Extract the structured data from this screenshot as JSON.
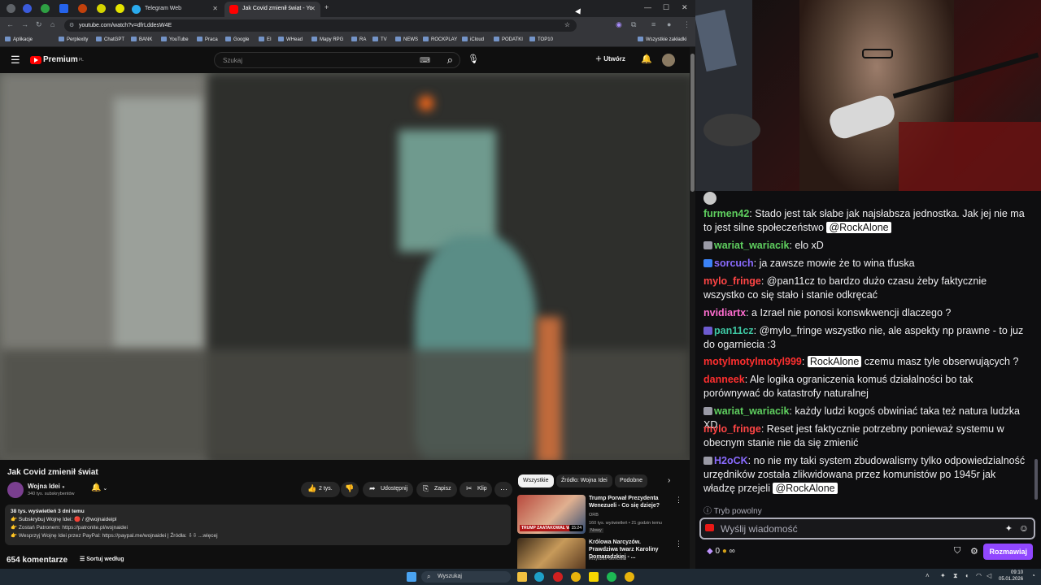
{
  "browser": {
    "tabs": [
      {
        "label": "Telegram Web"
      },
      {
        "label": "Jak Covid zmienił świat - Yo"
      }
    ],
    "url": "youtube.com/watch?v=dfrLddesW4E",
    "bookmarks": [
      "Aplikacje",
      "Perplexity",
      "ChatGPT",
      "BANK",
      "YouTube",
      "Praca",
      "Google",
      "EI",
      "WHead",
      "Mapy RPG",
      "RA",
      "TV",
      "NEWS",
      "ROCKPLAY",
      "iCloud",
      "PODATKI",
      "TOP10"
    ],
    "bookmarks_all": "Wszystkie zakładki"
  },
  "youtube": {
    "logo": "Premium",
    "logo_sup": "PL",
    "search_placeholder": "Szukaj",
    "create_label": "Utwórz",
    "video_title": "Jak Covid zmienił świat",
    "channel_name": "Wojna Idei",
    "subscribers": "340 tys. subskrybentów",
    "likes": "2 tys.",
    "share": "Udostępnij",
    "save": "Zapisz",
    "clip": "Klip",
    "desc_stats": "38 tys. wyświetleń  3 dni temu",
    "desc_lines": [
      "👉 Subskrybuj Wojnę Idei: 🔴 / @wojnaideipl",
      "👉 Zostań Patronem: https://patronite.pl/wojnaidei",
      "👉 Wesprzyj Wojnę Idei przez PayPal: https://paypal.me/wojnaidei  |  Źródła: ⇩⇩ ...więcej"
    ],
    "comments_count": "654 komentarze",
    "sort_label": "Sortuj według",
    "chips": [
      "Wszystkie",
      "Źródło: Wojna Idei",
      "Podobne"
    ],
    "related": [
      {
        "title": "Trump Porwał Prezydenta Wenezueli - Co się dzieje?",
        "channel": "ORB",
        "meta": "160 tys. wyświetleń • 21 godzin temu",
        "badge": "Nowy",
        "duration": "15:24",
        "thumb_caption": "TRUMP ZAATAKOWAŁ WEN"
      },
      {
        "title": "Królowa Narcyzów. Prawdziwa twarz Karoliny Domaradzkiej - ...",
        "channel": "Krzysztof Gonciarz"
      }
    ]
  },
  "chat": {
    "messages": [
      {
        "user": "furmen42",
        "color": "#5fcf5f",
        "text": ": Stado jest tak słabe jak najsłabsza jednostka. Jak jej nie ma to jest silne społeczeństwo ",
        "mention": "@RockAlone"
      },
      {
        "user": "wariat_wariacik",
        "color": "#5fcf5f",
        "text": ": elo xD"
      },
      {
        "user": "sorcuch",
        "color": "#8a6bff",
        "text": ": ja zawsze mowie że to wina tfuska"
      },
      {
        "user": "mylo_fringe",
        "color": "#ff4545",
        "text": ": @pan11cz to bardzo dużo czasu żeby faktycznie wszystko co się stało i stanie odkręcać"
      },
      {
        "user": "nvidiartx",
        "color": "#ff6ed0",
        "text": ": a Izrael nie ponosi konswkwencji dlaczego ?"
      },
      {
        "user": "pan11cz",
        "color": "#3ec7a3",
        "text": ": @mylo_fringe wszystko nie, ale aspekty np prawne - to juz do ogarniecia :3"
      },
      {
        "user": "motylmotylmotyl999",
        "color": "#ff2f2f",
        "text": ": ",
        "mention": "RockAlone",
        "text2": " czemu masz tyle obserwujących ?"
      },
      {
        "user": "danneek",
        "color": "#ff2f2f",
        "text": ": Ale logika ograniczenia komuś działalności bo tak porównywać do katastrofy naturalnej"
      },
      {
        "user": "wariat_wariacik",
        "color": "#5fcf5f",
        "text": ": każdy ludzi kogoś obwiniać taka też natura ludzka XD"
      },
      {
        "user": "mylo_fringe",
        "color": "#ff4545",
        "text": ": Reset jest faktycznie potrzebny ponieważ systemu w obecnym stanie nie da się zmienić"
      },
      {
        "user": "H2oCK",
        "color": "#8a6bff",
        "text": ": no nie my taki system zbudowalismy tylko odpowiedzialność urzędników została zlikwidowana przez komunistów po 1945r jak władzę przejeli ",
        "mention": "@RockAlone"
      }
    ],
    "slow_mode": "Tryb powolny",
    "input_placeholder": "Wyślij wiadomość",
    "points": "0",
    "points_extra": "∞",
    "send_button": "Rozmawiaj"
  },
  "taskbar": {
    "search": "Wyszukaj",
    "time": "09:10",
    "date": "05.01.2026"
  }
}
